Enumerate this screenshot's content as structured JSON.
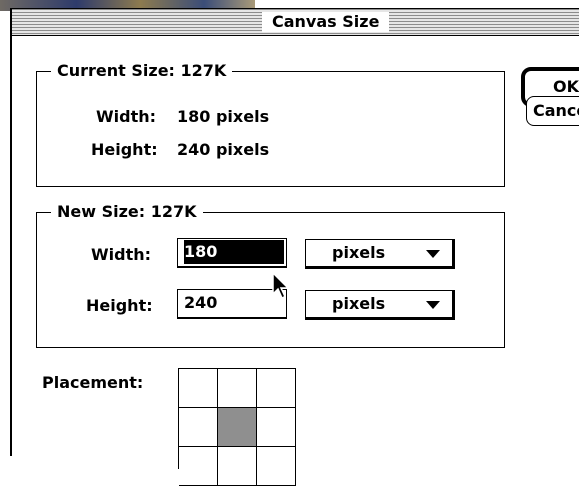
{
  "dialog": {
    "title": "Canvas Size"
  },
  "current_size": {
    "title": "Current Size: 127K",
    "width_label": "Width:",
    "width_value": "180 pixels",
    "height_label": "Height:",
    "height_value": "240 pixels"
  },
  "new_size": {
    "title": "New Size: 127K",
    "width_label": "Width:",
    "width_value": "180",
    "width_unit": "pixels",
    "height_label": "Height:",
    "height_value": "240",
    "height_unit": "pixels"
  },
  "placement": {
    "label": "Placement:",
    "selected": "center"
  },
  "buttons": {
    "ok": "OK",
    "cancel": "Cancel"
  }
}
